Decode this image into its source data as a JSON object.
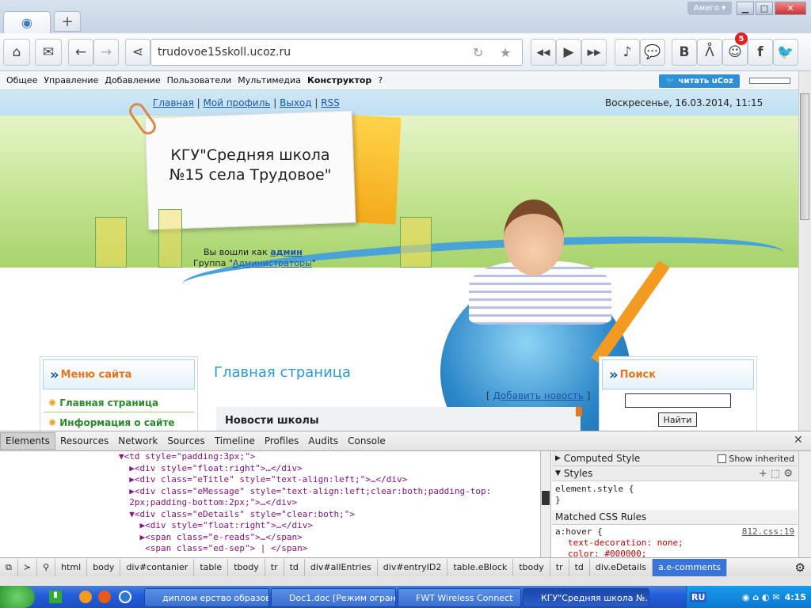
{
  "browser": {
    "new_tab": "+",
    "profile": "Амиго ▾",
    "url": "trudovoe15skoll.ucoz.ru",
    "badge": "5"
  },
  "ucoz_panel": {
    "menu": [
      "Общее",
      "Управление",
      "Добавление",
      "Пользователи",
      "Мультимедиа",
      "Конструктор",
      "?"
    ],
    "read_button": "читать uCoz"
  },
  "site": {
    "top_links": [
      "Главная",
      "Мой профиль",
      "Выход",
      "RSS"
    ],
    "datetime": "Воскресенье, 16.03.2014, 11:15",
    "title": "КГУ\"Средняя школа №15 села Трудовое\"",
    "login_prefix": "Вы вошли как",
    "login_user": "админ",
    "group_prefix": "Группа \"",
    "group_name": "Администраторы",
    "group_suffix": "\"",
    "menu_block_title": "Меню сайта",
    "menu_items": [
      "Главная страница",
      "Информация о сайте"
    ],
    "main_title": "Главная страница",
    "add_news": "Добавить новость",
    "news_title": "Новости школы",
    "search_block_title": "Поиск",
    "search_button": "Найти"
  },
  "devtools": {
    "tabs": [
      "Elements",
      "Resources",
      "Network",
      "Sources",
      "Timeline",
      "Profiles",
      "Audits",
      "Console"
    ],
    "dom_lines": [
      "▼<td style=\"padding:3px;\">",
      "  ▶<div style=\"float:right\">…</div>",
      "  ▶<div class=\"eTitle\" style=\"text-align:left;\">…</div>",
      "  ▶<div class=\"eMessage\" style=\"text-align:left;clear:both;padding-top:",
      "  2px;padding-bottom:2px;\">…</div>",
      "  ▼<div class=\"eDetails\" style=\"clear:both;\">",
      "    ▶<div style=\"float:right\">…</div>",
      "    ▶<span class=\"e-reads\">…</span>",
      "     <span class=\"ed-sep\"> | </span>"
    ],
    "computed_style": "Computed Style",
    "show_inherited": "Show inherited",
    "styles_label": "Styles",
    "element_style": "element.style {",
    "close_brace": "}",
    "matched_rules": "Matched CSS Rules",
    "rule_selector": "a:hover {",
    "rule_source": "812.css:19",
    "rule_prop": "text-decoration: none;",
    "rule_prop2": "color: #000000;",
    "breadcrumbs": [
      "html",
      "body",
      "div#contanier",
      "table",
      "tbody",
      "tr",
      "td",
      "div#allEntries",
      "div#entryID2",
      "table.eBlock",
      "tbody",
      "tr",
      "td",
      "div.eDetails",
      "a.e-comments"
    ]
  },
  "taskbar": {
    "tasks": [
      "диплом ерство образов...",
      "Doc1.doc [Режим огран...",
      "FWT Wireless Connect",
      "КГУ\"Средняя школа №..."
    ],
    "lang": "RU",
    "clock": "4:15"
  }
}
